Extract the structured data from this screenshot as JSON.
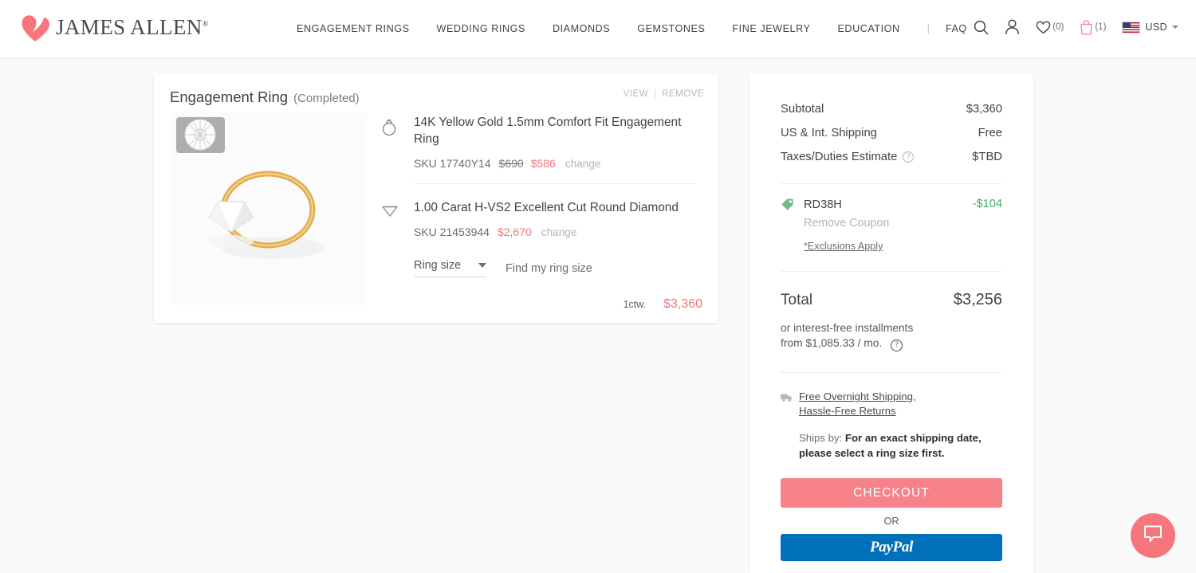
{
  "header": {
    "brand": "JAMES ALLEN",
    "brand_reg": "®",
    "nav": [
      {
        "label": "ENGAGEMENT RINGS",
        "name": "engagement-rings"
      },
      {
        "label": "WEDDING RINGS",
        "name": "wedding-rings"
      },
      {
        "label": "DIAMONDS",
        "name": "diamonds"
      },
      {
        "label": "GEMSTONES",
        "name": "gemstones"
      },
      {
        "label": "FINE JEWELRY",
        "name": "fine-jewelry"
      },
      {
        "label": "EDUCATION",
        "name": "education"
      }
    ],
    "nav_separator": "|",
    "faq": "FAQ",
    "wishlist_count": "(0)",
    "cart_count": "(1)",
    "currency": "USD",
    "icons": {
      "search": "search-icon",
      "account": "user-icon",
      "wishlist": "heart-icon",
      "cart": "shopping-bag-icon",
      "flag": "us-flag-icon",
      "caret": "chevron-down-icon"
    }
  },
  "card": {
    "title": "Engagement Ring",
    "status": "(Completed)",
    "view": "VIEW",
    "separator": "|",
    "remove": "REMOVE",
    "items": [
      {
        "icon": "ring-icon",
        "name": "14K Yellow Gold 1.5mm Comfort Fit Engagement Ring",
        "sku": "SKU 17740Y14",
        "price_original": "$690",
        "price_current": "$586",
        "change": "change"
      },
      {
        "icon": "diamond-icon",
        "name": "1.00 Carat H-VS2 Excellent Cut Round Diamond",
        "sku": "SKU 21453944",
        "price_original": "",
        "price_current": "$2,670",
        "change": "change"
      }
    ],
    "ring_size_label": "Ring size",
    "find_my_ring_size": "Find my ring size",
    "ctw": "1ctw.",
    "card_total": "$3,360"
  },
  "summary": {
    "rows": [
      {
        "label": "Subtotal",
        "value": "$3,360",
        "has_help": false
      },
      {
        "label": "US & Int. Shipping",
        "value": "Free",
        "has_help": false
      },
      {
        "label": "Taxes/Duties Estimate",
        "value": "$TBD",
        "has_help": true
      }
    ],
    "coupon": {
      "code": "RD38H",
      "amount": "-$104",
      "remove": "Remove Coupon",
      "exclusions": "*Exclusions Apply",
      "tag_color": "#6dbb84"
    },
    "total_label": "Total",
    "total_value": "$3,256",
    "installments_line1": "or interest-free installments",
    "installments_line2": "from $1,085.33 / mo.",
    "shipping_link_1": "Free Overnight Shipping",
    "shipping_link_sep": ",",
    "shipping_link_2": "Hassle-Free Returns",
    "ships_by_label": "Ships by:",
    "ships_by_value": "For an exact shipping date, please select a ring size first.",
    "checkout_label": "CHECKOUT",
    "or_label": "OR",
    "paypal_label": "PayPal",
    "help_glyph": "?"
  },
  "chat": {
    "icon": "chat-bubble-icon"
  },
  "colors": {
    "accent_pink": "#f7828a",
    "paypal_blue": "#0070ba",
    "coupon_green": "#4aab68",
    "page_bg": "#fafafa"
  }
}
